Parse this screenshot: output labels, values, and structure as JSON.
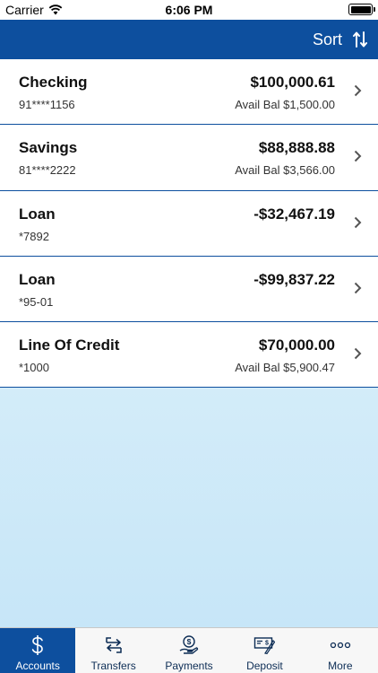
{
  "status_bar": {
    "carrier": "Carrier",
    "time": "6:06 PM"
  },
  "nav": {
    "sort_label": "Sort"
  },
  "accounts": [
    {
      "name": "Checking",
      "number": "91****1156",
      "balance": "$100,000.61",
      "avail": "Avail Bal $1,500.00"
    },
    {
      "name": "Savings",
      "number": "81****2222",
      "balance": "$88,888.88",
      "avail": "Avail Bal $3,566.00"
    },
    {
      "name": "Loan",
      "number": "*7892",
      "balance": "-$32,467.19",
      "avail": ""
    },
    {
      "name": "Loan",
      "number": "*95-01",
      "balance": "-$99,837.22",
      "avail": ""
    },
    {
      "name": "Line Of Credit",
      "number": "*1000",
      "balance": "$70,000.00",
      "avail": "Avail Bal $5,900.47"
    }
  ],
  "tabs": [
    {
      "label": "Accounts",
      "icon": "dollar-icon",
      "active": true
    },
    {
      "label": "Transfers",
      "icon": "transfer-arrows-icon",
      "active": false
    },
    {
      "label": "Payments",
      "icon": "hand-dollar-icon",
      "active": false
    },
    {
      "label": "Deposit",
      "icon": "check-deposit-icon",
      "active": false
    },
    {
      "label": "More",
      "icon": "ellipsis-icon",
      "active": false
    }
  ],
  "colors": {
    "brand_blue": "#0d4f9e",
    "empty_area": "#cde9f8",
    "tab_bar_bg": "#f7f7f7"
  }
}
